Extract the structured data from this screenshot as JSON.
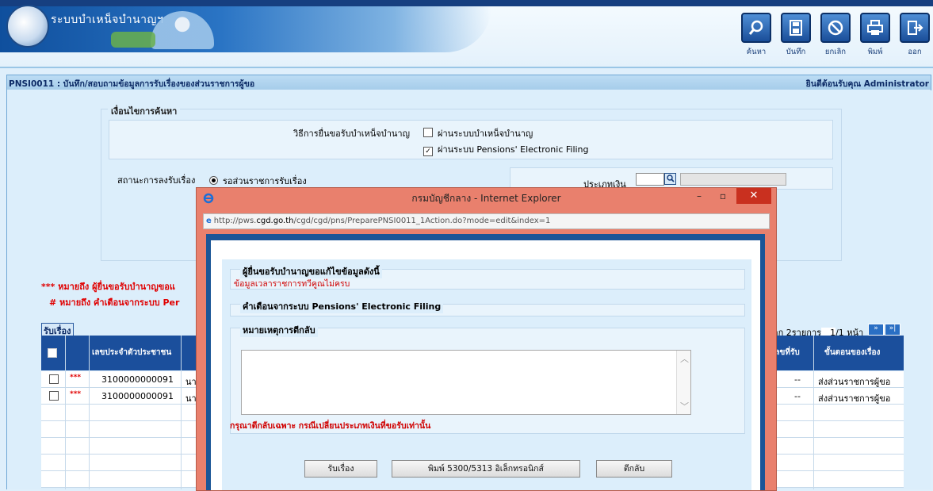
{
  "app": {
    "name": "ระบบบำเหน็จบำนาญฯ",
    "toolbar": [
      {
        "label": "ค้นหา",
        "icon": "search-icon"
      },
      {
        "label": "บันทึก",
        "icon": "save-icon"
      },
      {
        "label": "ยกเลิก",
        "icon": "cancel-icon"
      },
      {
        "label": "พิมพ์",
        "icon": "print-icon"
      },
      {
        "label": "ออก",
        "icon": "exit-icon"
      }
    ]
  },
  "page": {
    "title": "PNSI0011 : บันทึก/สอบถามข้อมูลการรับเรื่องของส่วนราชการผู้ขอ",
    "welcome": "ยินดีต้อนรับคุณ Administrator"
  },
  "search": {
    "legend": "เงื่อนไขการค้นหา",
    "submit_method_label": "วิธีการยื่นขอรับบำเหน็จบำนาญ",
    "option_system": "ผ่านระบบบำเหน็จบำนาญ",
    "option_system_checked": false,
    "option_efiling": "ผ่านระบบ Pensions' Electronic Filing",
    "option_efiling_checked": true,
    "status_label": "สถานะการลงรับเรื่อง",
    "status_option": "รอส่วนราชการรับเรื่อง",
    "money_type_label": "ประเภทเงิน",
    "money_type_value": ""
  },
  "notes": {
    "note1": "*** หมายถึง ผู้ยื่นขอรับบำนาญขอแ",
    "note2": "# หมายถึง คำเตือนจากระบบ Per"
  },
  "grid": {
    "receive_button": "รับเรื่อง",
    "paging_text": "จาก 2รายการ",
    "page_input": "1",
    "page_suffix": "/1 หน้า",
    "headers": {
      "citizen_id": "เลขประจำตัวประชาชน",
      "receive_no": "เลขที่รับ",
      "step": "ขั้นตอนของเรื่อง"
    },
    "rows": [
      {
        "mark": "***",
        "citizen_id": "3100000000091",
        "name_frag": "นา",
        "receive_no": "--",
        "step": "ส่งส่วนราชการผู้ขอ"
      },
      {
        "mark": "***",
        "citizen_id": "3100000000091",
        "name_frag": "นา",
        "receive_no": "--",
        "step": "ส่งส่วนราชการผู้ขอ"
      }
    ]
  },
  "popup": {
    "title": "กรมบัญชีกลาง - Internet Explorer",
    "url_prefix": "http://pws.",
    "url_host": "cgd.go.th",
    "url_rest": "/cgd/cgd/pns/PreparePNSI0011_1Action.do?mode=edit&index=1",
    "section1_legend": "ผู้ยื่นขอรับบำนาญขอแก้ไขข้อมูลดังนี้",
    "section1_text": "ข้อมูลเวลาราชการทวีคูณไม่ครบ",
    "section2_legend": "คำเตือนจากระบบ Pensions' Electronic Filing",
    "section3_legend": "หมายเหตุการตีกลับ",
    "reject_note": "กรุณาตีกลับเฉพาะ กรณีเปลี่ยนประเภทเงินที่ขอรับเท่านั้น",
    "btn_receive": "รับเรื่อง",
    "btn_print": "พิมพ์ 5300/5313 อิเล็กทรอนิกส์",
    "btn_return": "ตีกลับ"
  }
}
